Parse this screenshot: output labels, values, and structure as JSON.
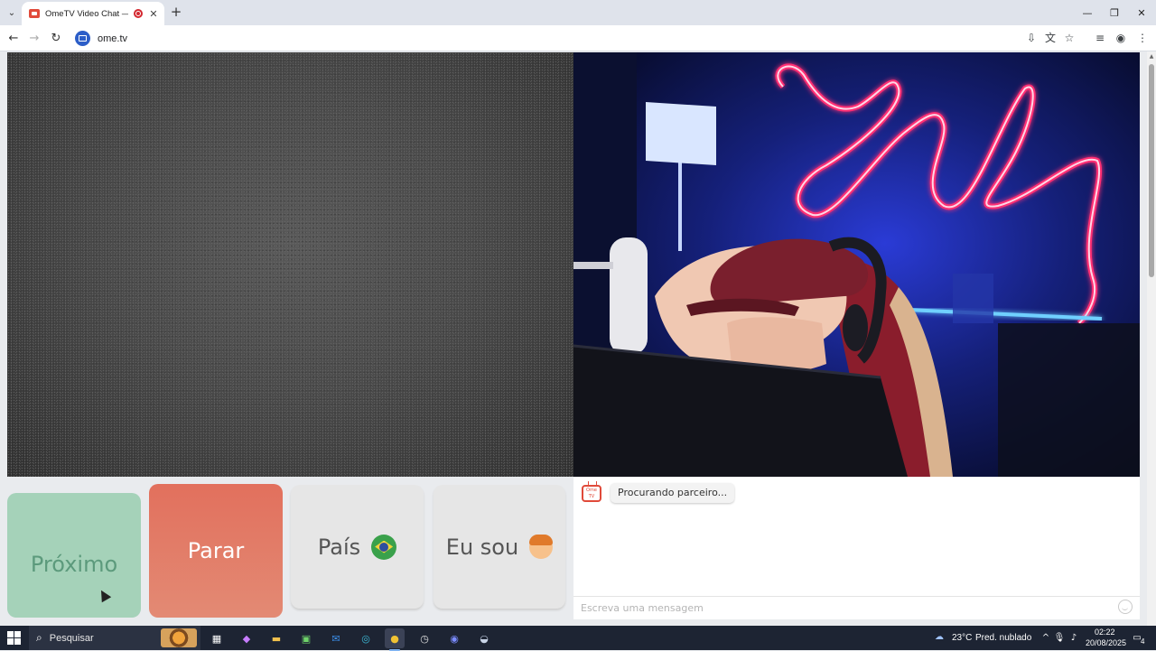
{
  "browser": {
    "tab_title": "OmeTV Video Chat — Ome",
    "url": "ome.tv"
  },
  "page": {
    "buttons": {
      "next": "Próximo",
      "stop": "Parar",
      "country": "País",
      "gender": "Eu sou"
    },
    "chat": {
      "logo_text": "Ome TV",
      "status_message": "Procurando parceiro...",
      "input_placeholder": "Escreva uma mensagem"
    }
  },
  "taskbar": {
    "search_label": "Pesquisar",
    "weather_temp": "23°C",
    "weather_desc": "Pred. nublado",
    "time": "02:22",
    "date": "20/08/2025",
    "notifications": "4"
  },
  "colors": {
    "next_button": "#a5d2b9",
    "stop_button": "#e2705d",
    "neutral_button": "#e6e6e6",
    "neon_pink": "#ff2f73",
    "neon_blue": "#2c4dff"
  }
}
